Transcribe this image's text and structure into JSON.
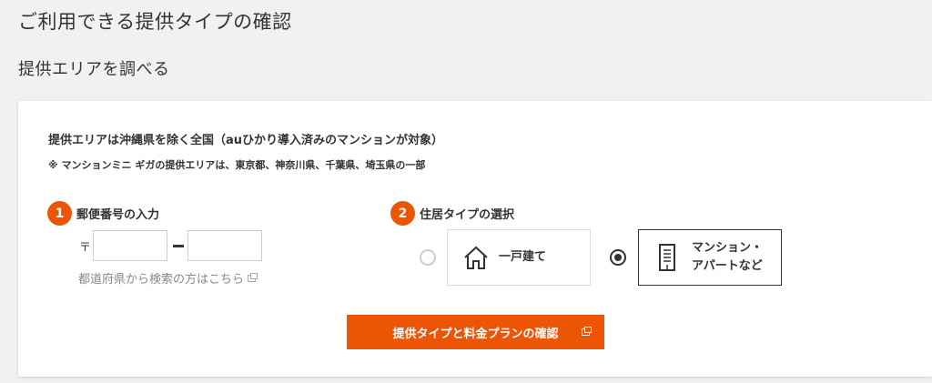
{
  "header": {
    "page_title": "ご利用できる提供タイプの確認",
    "section_title": "提供エリアを調べる"
  },
  "card": {
    "description": "提供エリアは沖縄県を除く全国（auひかり導入済みのマンションが対象）",
    "note": "※ マンションミニ ギガの提供エリアは、東京都、神奈川県、千葉県、埼玉県の一部"
  },
  "step1": {
    "number": "1",
    "label": "郵便番号の入力",
    "postal_mark": "〒",
    "postal_first_value": "",
    "postal_second_value": "",
    "prefecture_link": "都道府県から検索の方はこちら"
  },
  "step2": {
    "number": "2",
    "label": "住居タイプの選択",
    "options": [
      {
        "label": "一戸建て",
        "selected": false
      },
      {
        "label_line1": "マンション・",
        "label_line2": "アパートなど",
        "selected": true
      }
    ]
  },
  "submit": {
    "label": "提供タイプと料金プランの確認"
  },
  "colors": {
    "accent": "#eb5505",
    "background": "#f1f1f1",
    "text": "#333333"
  },
  "icons": [
    "house-icon",
    "apartment-icon",
    "external-link-icon"
  ]
}
